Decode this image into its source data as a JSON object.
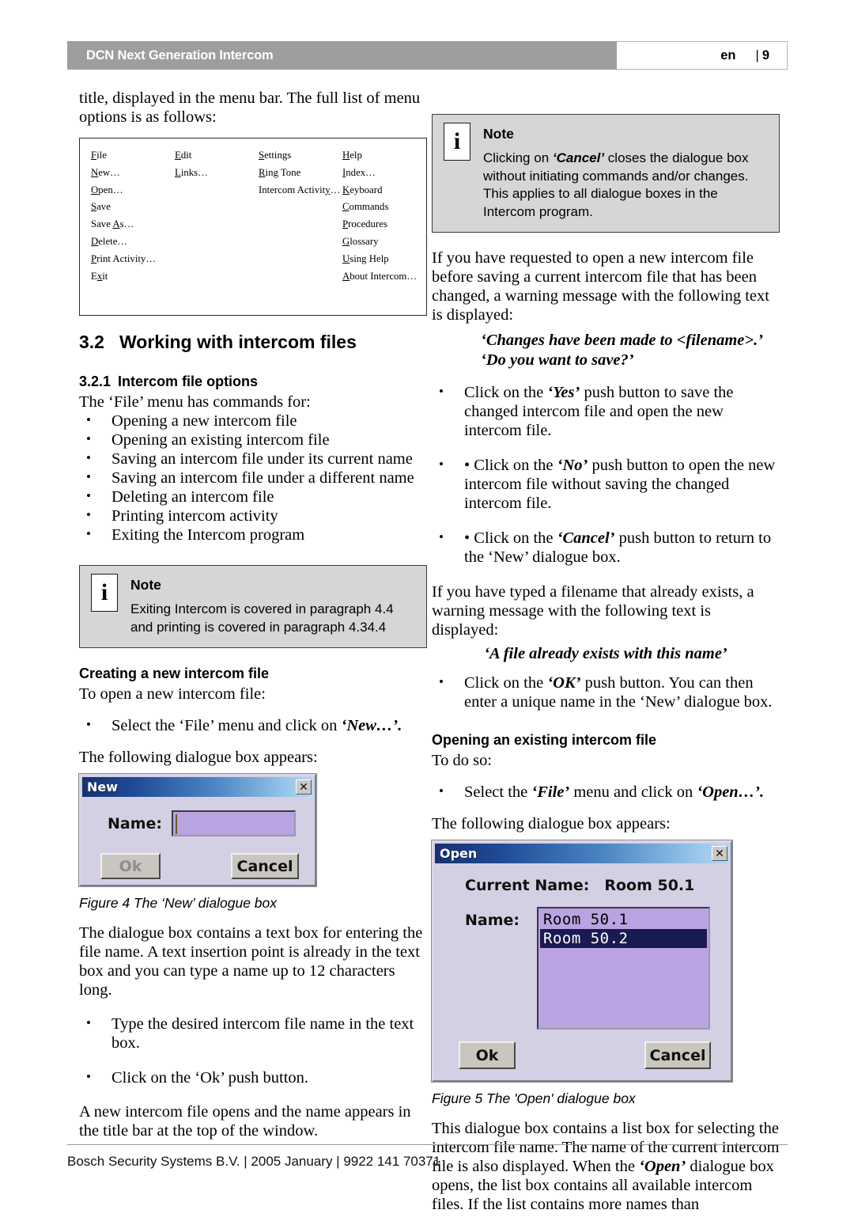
{
  "header": {
    "title": "DCN Next Generation Intercom",
    "language": "en",
    "separator": "|",
    "page": "9"
  },
  "left": {
    "intro": "title, displayed in the menu bar. The full list of menu options is as follows:",
    "menu_table": {
      "columns": [
        {
          "heading": "File",
          "items": [
            "New…",
            "Open…",
            "Save",
            "Save As…",
            "Delete…",
            "Print Activity…",
            "Exit"
          ]
        },
        {
          "heading": "Edit",
          "items": [
            "Links…"
          ]
        },
        {
          "heading": "Settings",
          "items": [
            "Ring Tone",
            "Intercom Activity…"
          ]
        },
        {
          "heading": "Help",
          "items": [
            "Index…",
            "Keyboard",
            "Commands",
            "Procedures",
            "Glossary",
            "Using Help",
            "About Intercom…"
          ]
        }
      ]
    },
    "section_number": "3.2",
    "section_title": "Working with intercom files",
    "subsection_number": "3.2.1",
    "subsection_title": "Intercom file options",
    "file_menu_intro": "The ‘File’ menu has commands for:",
    "file_menu_bullets": [
      "Opening a new intercom file",
      "Opening an existing intercom file",
      "Saving an intercom file under its current name",
      "Saving an intercom file under a different name",
      "Deleting an intercom file",
      "Printing intercom activity",
      "Exiting the Intercom program"
    ],
    "note": {
      "icon": "i",
      "title": "Note",
      "line1": "Exiting Intercom is covered in paragraph 4.4",
      "line2": "and printing is covered in paragraph 4.34.4"
    },
    "creating_heading": "Creating a new intercom file",
    "creating_intro": "To open a new intercom file:",
    "creating_bullet_pre": "Select the ‘File’ menu and click on ",
    "creating_bullet_em": "‘New…’.",
    "dialog_appears": "The following dialogue box appears:",
    "new_dialog": {
      "title": "New",
      "close_glyph": "✕",
      "name_label": "Name:",
      "name_value": "",
      "ok_label": "Ok",
      "cancel_label": "Cancel"
    },
    "figure4_caption": "Figure 4 The ‘New’ dialogue box",
    "after_fig4": "The dialogue box contains a text box for entering the file name. A text insertion point is already in the text box and you can type a name up to 12 characters long.",
    "after_fig4_bullets": [
      "Type the desired intercom file name in the text box.",
      "Click on the ‘Ok’ push button."
    ],
    "closing": "A new intercom file opens and the name appears in the title bar at the top of the window."
  },
  "right": {
    "note": {
      "icon": "i",
      "title": "Note",
      "text_pre": "Clicking on ",
      "text_em": "‘Cancel’",
      "text_post": " closes the dialogue box without initiating commands and/or changes. This applies to all dialogue boxes in the Intercom program."
    },
    "para1": "If you have requested to open a new intercom file before saving a current intercom file that has been changed, a warning message with the following text is displayed:",
    "quote1_line1": "‘Changes have been made to <filename>.’",
    "quote1_line2": "‘Do you want to save?’",
    "bullets1": [
      {
        "pre": "Click on the ",
        "em": "‘Yes’",
        "post": " push button to save the changed intercom file and open the new intercom file."
      },
      {
        "pre": "• Click on the ",
        "em": "‘No’",
        "post": " push button to open the new intercom file without saving the changed intercom file."
      },
      {
        "pre": "• Click on the ",
        "em": "‘Cancel’",
        "post": " push button to return to the ‘New’ dialogue box."
      }
    ],
    "para2": "If you have typed a filename that already exists, a warning message with the following text is displayed:",
    "quote2": "‘A file already exists with this name’",
    "bullets2": [
      {
        "pre": "Click on the ",
        "em": "‘OK’",
        "post": " push button. You can then enter a unique name in the ‘New’ dialogue box."
      }
    ],
    "opening_heading": "Opening an existing intercom file",
    "opening_intro": "To do so:",
    "opening_bullet_pre": "Select the ",
    "opening_bullet_em1": "‘File’",
    "opening_bullet_mid": " menu and click on ",
    "opening_bullet_em2": "‘Open…’.",
    "dialog_appears": "The following dialogue box appears:",
    "open_dialog": {
      "title": "Open",
      "close_glyph": "✕",
      "current_name_label": "Current Name:",
      "current_name_value": "Room 50.1",
      "name_label": "Name:",
      "list_items": [
        "Room 50.1",
        "Room 50.2"
      ],
      "selected_index": 1,
      "ok_label": "Ok",
      "cancel_label": "Cancel"
    },
    "figure5_caption": "Figure 5 The 'Open' dialogue box",
    "after_fig5_pre": "This dialogue box contains a list box for selecting the intercom file name. The name of the current intercom file is also displayed. When the ",
    "after_fig5_em": "‘Open’",
    "after_fig5_post": " dialogue box opens, the list box contains all available intercom files. If the list contains more names than"
  },
  "footer": {
    "text": "Bosch Security Systems B.V. | 2005 January | 9922 141 70371"
  },
  "colors": {
    "header_bar": "#9e9e9e",
    "note_bg": "#d6d6d6",
    "dialog_face": "#d4d0e4",
    "field_purple": "#b9a3e0",
    "selection_navy": "#1a1a52"
  }
}
